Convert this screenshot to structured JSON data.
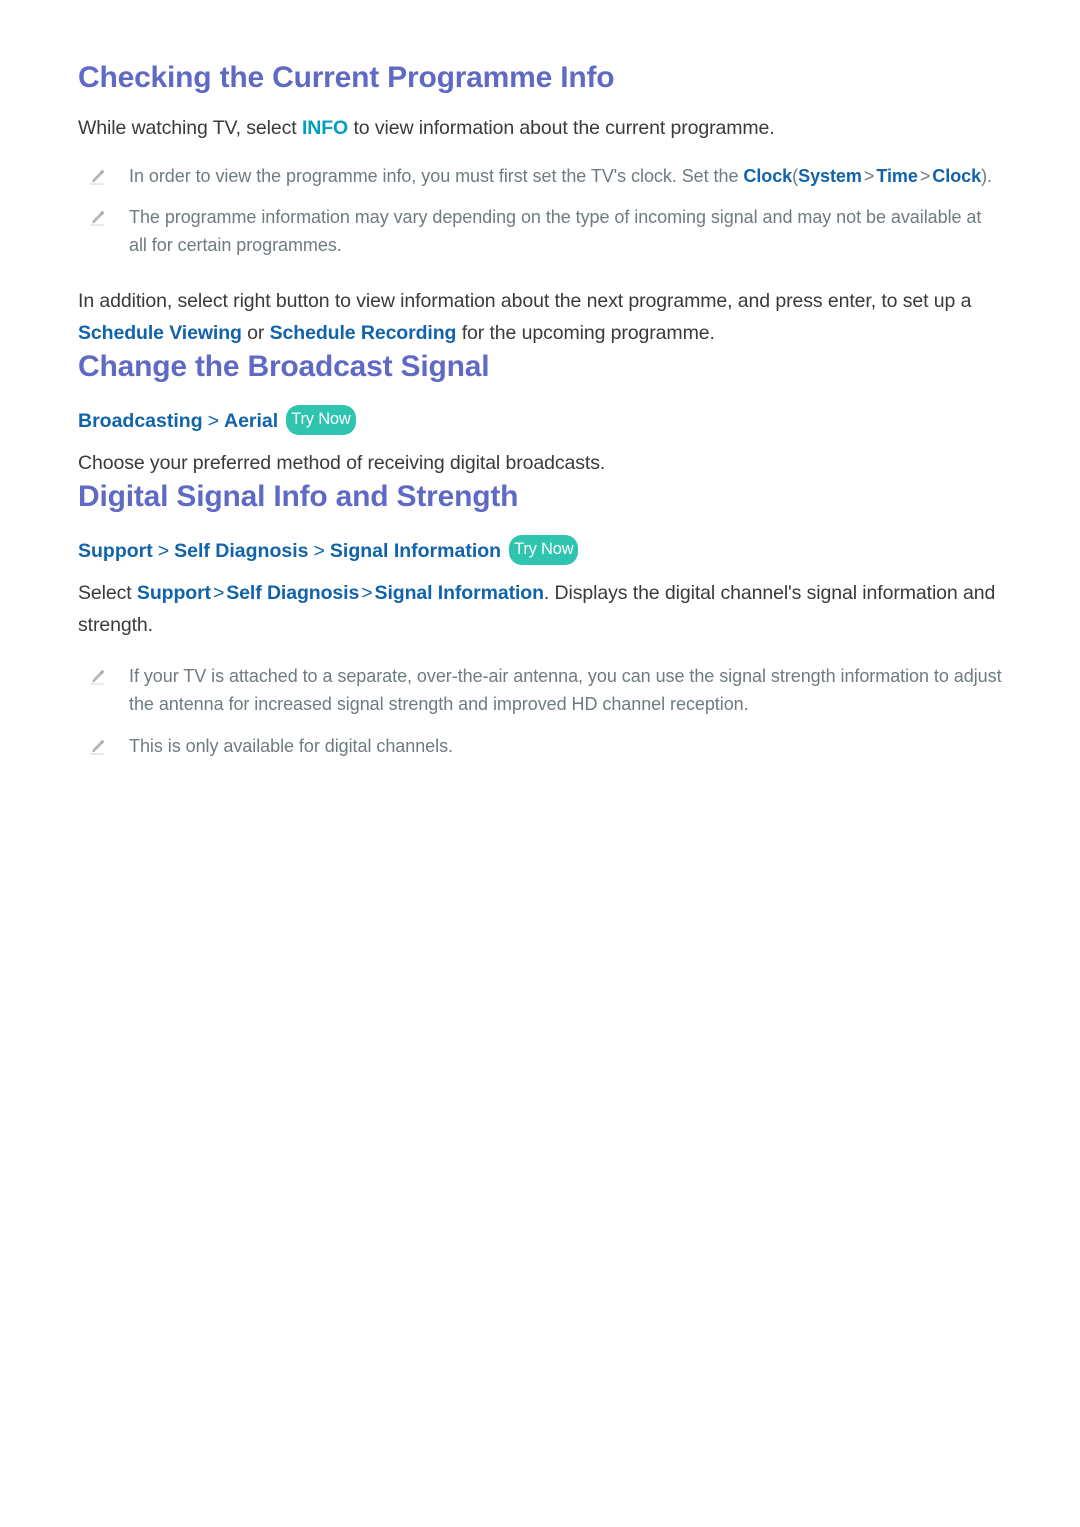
{
  "colors": {
    "heading": "#5f6ac4",
    "body": "#3a3a3a",
    "menu_blue": "#1163ac",
    "accent_teal": "#00a0bd",
    "badge_bg": "#2ec4b0",
    "note_text": "#6e7b81",
    "background": "#ffffff"
  },
  "icons": {
    "note_bullet": "pencil-icon"
  },
  "badges": {
    "try_now": "Try Now"
  },
  "sections": [
    {
      "id": "checking-current-programme-info",
      "heading": "Checking the Current Programme Info",
      "intro": {
        "pre": "While watching TV, select ",
        "keyword": "INFO",
        "post": " to view information about the current programme."
      },
      "notes": [
        {
          "pre": "In order to view the programme info, you must first set the TV's clock. Set the ",
          "term": "Clock",
          "path_open": "(",
          "path": [
            "System",
            "Time",
            "Clock"
          ],
          "path_close": ")",
          "post": "."
        },
        {
          "text": "The programme information may vary depending on the type of incoming signal and may not be available at all for certain programmes."
        }
      ],
      "closing": {
        "pre": "In addition, select right button to view information about the next programme, and press enter, to set up a ",
        "link1": "Schedule Viewing",
        "mid": " or ",
        "link2": "Schedule Recording",
        "post": " for the upcoming programme."
      }
    },
    {
      "id": "change-the-broadcast-signal",
      "heading": "Change the Broadcast Signal",
      "menu_path": [
        "Broadcasting",
        "Aerial"
      ],
      "has_try_now": true,
      "body": "Choose your preferred method of receiving digital broadcasts."
    },
    {
      "id": "digital-signal-info-and-strength",
      "heading": "Digital Signal Info and Strength",
      "menu_path": [
        "Support",
        "Self Diagnosis",
        "Signal Information"
      ],
      "has_try_now": true,
      "body": {
        "pre": "Select ",
        "path": [
          "Support",
          "Self Diagnosis",
          "Signal Information"
        ],
        "post": ". Displays the digital channel's signal information and strength."
      },
      "notes": [
        {
          "text": "If your TV is attached to a separate, over-the-air antenna, you can use the signal strength information to adjust the antenna for increased signal strength and improved HD channel reception."
        },
        {
          "text": "This is only available for digital channels."
        }
      ]
    }
  ]
}
